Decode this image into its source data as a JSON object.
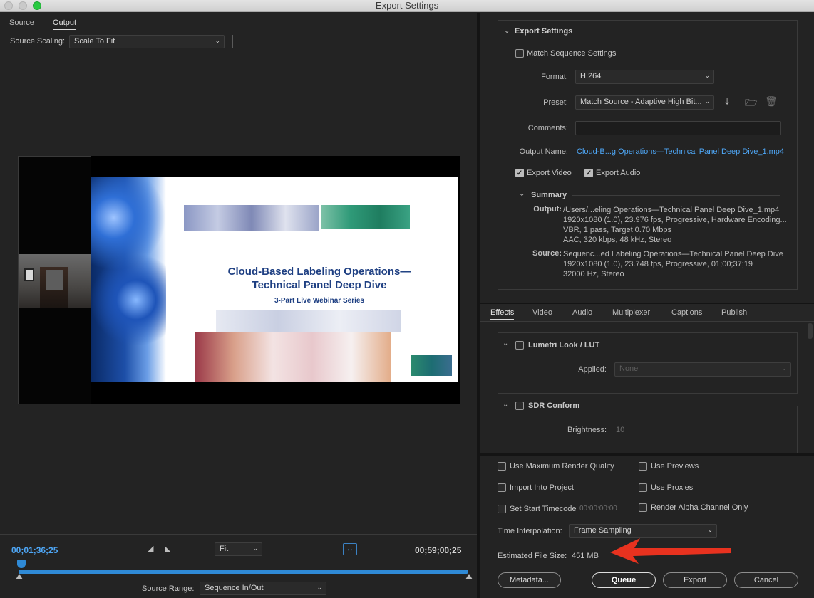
{
  "window": {
    "title": "Export Settings"
  },
  "left": {
    "tabs": [
      "Source",
      "Output"
    ],
    "source_scaling_label": "Source Scaling:",
    "source_scaling_value": "Scale To Fit",
    "slide": {
      "title_line1": "Cloud-Based Labeling Operations—",
      "title_line2": "Technical Panel Deep Dive",
      "subtitle": "3-Part Live Webinar Series"
    },
    "timeline": {
      "current_timecode": "00;01;36;25",
      "fit_value": "Fit",
      "end_timecode": "00;59;00;25",
      "source_range_label": "Source Range:",
      "source_range_value": "Sequence In/Out"
    }
  },
  "export_settings": {
    "header": "Export Settings",
    "match_sequence_label": "Match Sequence Settings",
    "format_label": "Format:",
    "format_value": "H.264",
    "preset_label": "Preset:",
    "preset_value": "Match Source - Adaptive High Bit...",
    "comments_label": "Comments:",
    "comments_value": "",
    "output_name_label": "Output Name:",
    "output_name_value": "Cloud-B...g Operations—Technical Panel Deep Dive_1.mp4",
    "export_video_label": "Export Video",
    "export_audio_label": "Export Audio",
    "summary_header": "Summary",
    "output_label": "Output:",
    "output_lines": [
      "/Users/...eling Operations—Technical Panel Deep Dive_1.mp4",
      "1920x1080 (1.0), 23.976 fps, Progressive, Hardware Encoding...",
      "VBR, 1 pass, Target 0.70 Mbps",
      "AAC, 320 kbps, 48 kHz, Stereo"
    ],
    "source_label": "Source:",
    "source_lines": [
      "Sequenc...ed Labeling Operations—Technical Panel Deep Dive",
      "1920x1080 (1.0), 23.748 fps, Progressive, 01;00;37;19",
      "32000 Hz, Stereo"
    ]
  },
  "effects_tabs": [
    "Effects",
    "Video",
    "Audio",
    "Multiplexer",
    "Captions",
    "Publish"
  ],
  "effects": {
    "lumetri_header": "Lumetri Look / LUT",
    "applied_label": "Applied:",
    "applied_value": "None",
    "sdr_header": "SDR Conform",
    "brightness_label": "Brightness:",
    "brightness_value": "10"
  },
  "options": {
    "max_render_quality": "Use Maximum Render Quality",
    "use_previews": "Use Previews",
    "import_into_project": "Import Into Project",
    "use_proxies": "Use Proxies",
    "set_start_timecode": "Set Start Timecode",
    "start_timecode_value": "00:00:00:00",
    "render_alpha": "Render Alpha Channel Only",
    "time_interpolation_label": "Time Interpolation:",
    "time_interpolation_value": "Frame Sampling",
    "est_file_size_label": "Estimated File Size:",
    "est_file_size_value": "451 MB"
  },
  "buttons": {
    "metadata": "Metadata...",
    "queue": "Queue",
    "export": "Export",
    "cancel": "Cancel"
  },
  "colors": {
    "accent": "#4ea6f5",
    "arrow": "#e8321f"
  }
}
